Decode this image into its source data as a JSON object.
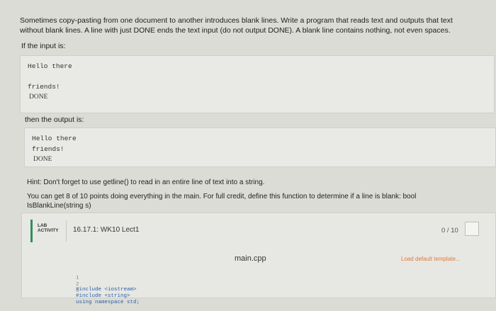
{
  "intro": {
    "line1": "Sometimes copy-pasting from one document to another introduces blank lines. Write a program that reads text and outputs that text",
    "line2": "without blank lines. A line with just DONE ends the text input (do not output DONE). A blank line contains nothing, not even spaces."
  },
  "input_label": "If the input is:",
  "input_lines": [
    "Hello there",
    "friends!",
    "DONE"
  ],
  "output_label": "then the output is:",
  "output_lines": [
    "Hello there",
    "friends!",
    "DONE"
  ],
  "hint": {
    "line1": "Hint: Don't forget to use getline() to read in an entire line of text into a string.",
    "line2": "You can get 8 of 10 points doing everything in the main. For full credit, define this function to determine if a line is blank: bool",
    "line3": "IsBlankLine(string s)"
  },
  "lab": {
    "tag_line1": "LAB",
    "tag_line2": "ACTIVITY",
    "title": "16.17.1: WK10 Lect1",
    "score": "0 / 10",
    "filename": "main.cpp",
    "template_link": "Load default template...",
    "code": [
      {
        "num": "1",
        "text": "#include <iostream>"
      },
      {
        "num": "2",
        "text": "#include <string>"
      },
      {
        "num": "3",
        "text": "using namespace std;"
      }
    ]
  },
  "colors": {
    "accent_bar": "#2f8f5a",
    "template_link": "#e07a3a"
  }
}
